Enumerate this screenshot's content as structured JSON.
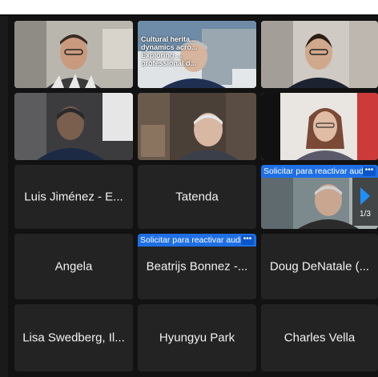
{
  "participants": {
    "luis": "Luis Jiménez - E...",
    "tatenda": "Tatenda",
    "angela": "Angela",
    "beatrijs": "Beatrijs Bonnez -...",
    "doug": "Doug DeNatale (...",
    "lisa": "Lisa Swedberg, Il...",
    "hyungyu": "Hyungyu Park",
    "charles": "Charles Vella"
  },
  "unmute_request_label": "Solicitar para reactivar audio",
  "more_button_label": "•••",
  "slide_text": "Cultural herita... dynamics acro... Exploring ... professional d...",
  "pagination": {
    "page_indicator": "1/3"
  }
}
